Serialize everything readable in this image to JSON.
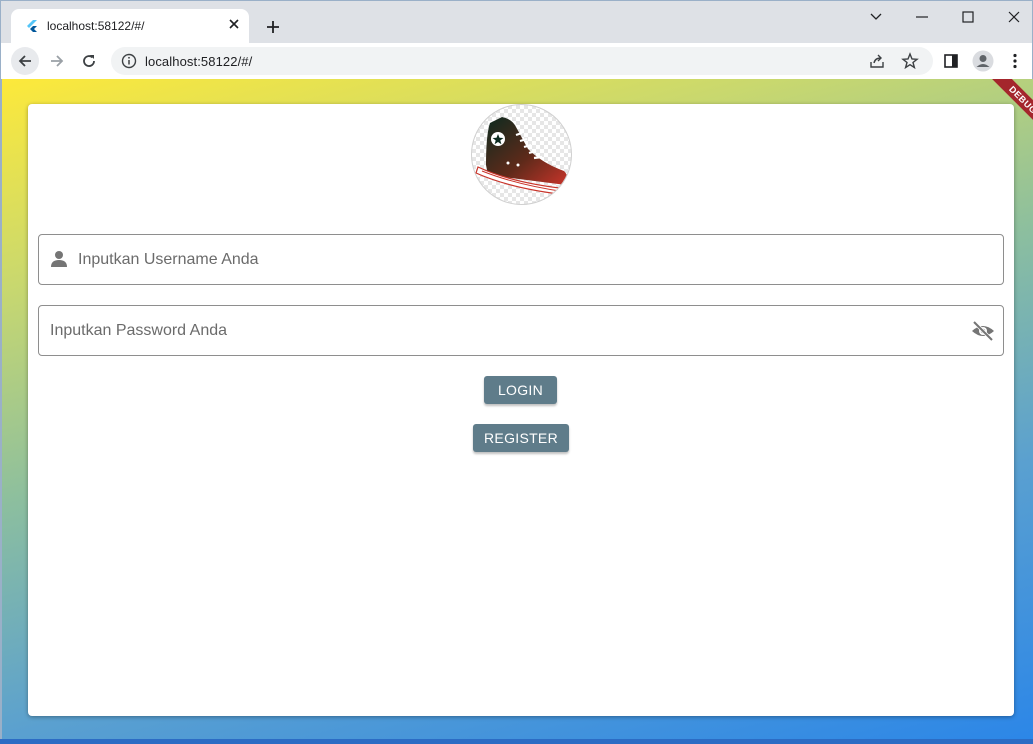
{
  "browser": {
    "tab": {
      "title": "localhost:58122/#/",
      "favicon": "flutter-icon"
    },
    "address_bar": {
      "url": "localhost:58122/#/"
    },
    "icons": [
      "back-icon",
      "forward-icon",
      "reload-icon",
      "info-icon",
      "share-icon",
      "star-icon",
      "side-panel-icon",
      "profile-icon",
      "menu-icon",
      "minimize-icon",
      "maximize-icon",
      "close-icon",
      "chevron-down-icon",
      "plus-icon"
    ]
  },
  "login_form": {
    "logo": "sneaker-logo",
    "username": {
      "placeholder": "Inputkan Username Anda",
      "icon": "person-icon"
    },
    "password": {
      "placeholder": "Inputkan Password Anda",
      "icon": "visibility-off-icon"
    },
    "login_button": "LOGIN",
    "register_button": "REGISTER"
  },
  "debug_banner": "DEBUG",
  "colors": {
    "button": "#5f7c8a",
    "gradient_start": "#fde93a",
    "gradient_end": "#2b86e8",
    "debug_banner": "#a4262c"
  }
}
